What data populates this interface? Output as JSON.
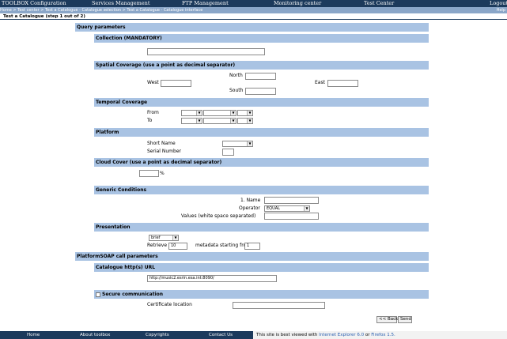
{
  "topnav": {
    "items": [
      "TOOLBOX Configuration",
      "Services Management",
      "FTP Management",
      "Monitoring center",
      "Test Center",
      "Logout"
    ]
  },
  "breadcrumb": {
    "text": "Home > Test center > Test a Catalogue - Catalogue selection > Test a Catalogue - Catalogue interface",
    "help": "Help"
  },
  "page_title": "Test a Catalogue (step 1 out of 2)",
  "form": {
    "query_parameters": "Query parameters",
    "collection": {
      "title": "Collection (MANDATORY)",
      "value": ""
    },
    "spatial": {
      "title": "Spatial Coverage (use a point as decimal separator)",
      "north": "North",
      "south": "South",
      "west": "West",
      "east": "East"
    },
    "temporal": {
      "title": "Temporal Coverage",
      "from": "From",
      "to": "To"
    },
    "platform": {
      "title": "Platform",
      "short_name": "Short Name",
      "serial_number": "Serial Number"
    },
    "cloud": {
      "title": "Cloud Cover (use a point as decimal separator)",
      "unit": "%"
    },
    "generic": {
      "title": "Generic Conditions",
      "name_label": "1. Name",
      "operator_label": "Operator",
      "operator_value": "EQUAL",
      "values_label": "Values (white space separated)"
    },
    "presentation": {
      "title": "Presentation",
      "format_value": "brief",
      "retrieve_label": "Retrieve",
      "retrieve_value": "10",
      "starting_label": "metadata starting from",
      "starting_value": "1"
    },
    "soap": "PlatformSOAP call parameters",
    "catalogue_url": {
      "title": "Catalogue http(s) URL",
      "value": "http://music2.esrin.esa.int:8090/"
    },
    "secure": {
      "title": "Secure communication",
      "certificate_label": "Certificate location",
      "checked": false
    },
    "back_button": "<< Back",
    "send_button": "Send"
  },
  "footer": {
    "items": [
      "Home",
      "About toolbox",
      "Copyrights",
      "Contact Us"
    ],
    "note_prefix": "This site is best viewed with",
    "ie_link": "Internet Explorer 6.0",
    "note_or": "or",
    "ff_link": "Firefox 1.5."
  }
}
